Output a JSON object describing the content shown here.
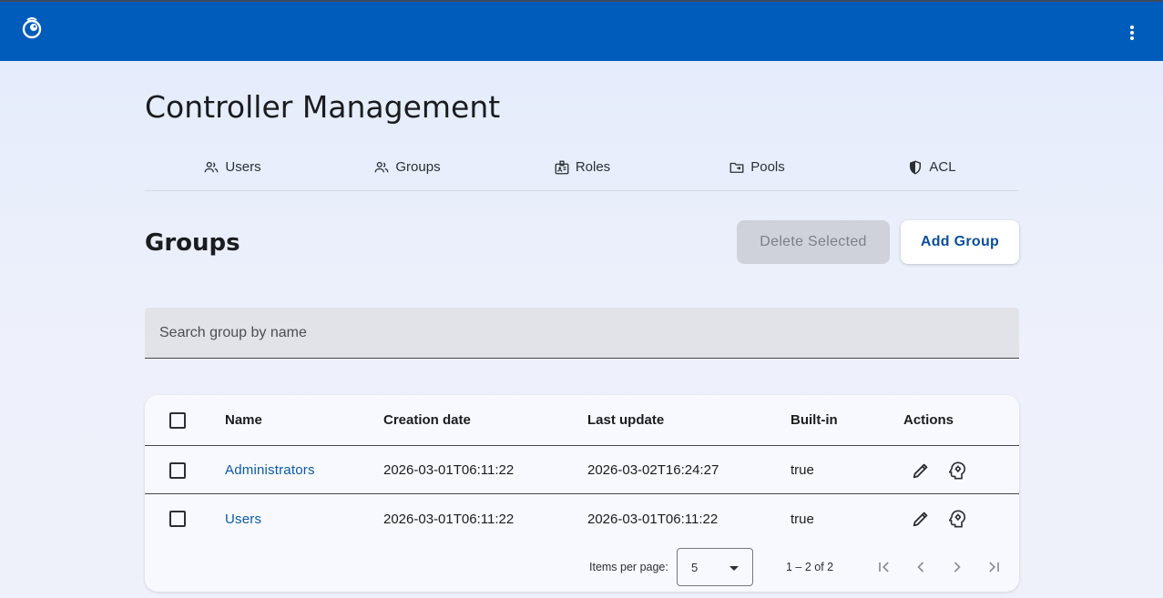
{
  "header": {
    "logo_icon": "app-logo-icon",
    "menu_icon": "more-vert-icon"
  },
  "page": {
    "title": "Controller Management"
  },
  "tabs": [
    {
      "label": "Users",
      "icon": "people-icon"
    },
    {
      "label": "Groups",
      "icon": "people-icon"
    },
    {
      "label": "Roles",
      "icon": "badge-icon"
    },
    {
      "label": "Pools",
      "icon": "folder-icon"
    },
    {
      "label": "ACL",
      "icon": "shield-icon"
    }
  ],
  "section": {
    "title": "Groups",
    "delete_label": "Delete Selected",
    "add_label": "Add Group"
  },
  "search": {
    "placeholder": "Search group by name",
    "value": ""
  },
  "table": {
    "columns": {
      "name": "Name",
      "created": "Creation date",
      "updated": "Last update",
      "builtin": "Built-in",
      "actions": "Actions"
    },
    "rows": [
      {
        "name": "Administrators",
        "created": "2026-03-01T06:11:22",
        "updated": "2026-03-02T16:24:27",
        "builtin": "true"
      },
      {
        "name": "Users",
        "created": "2026-03-01T06:11:22",
        "updated": "2026-03-01T06:11:22",
        "builtin": "true"
      }
    ]
  },
  "paginator": {
    "items_label": "Items per page:",
    "page_size": "5",
    "range": "1 – 2 of 2"
  },
  "colors": {
    "header_bg": "#005cbb",
    "link": "#0a5aa8"
  }
}
